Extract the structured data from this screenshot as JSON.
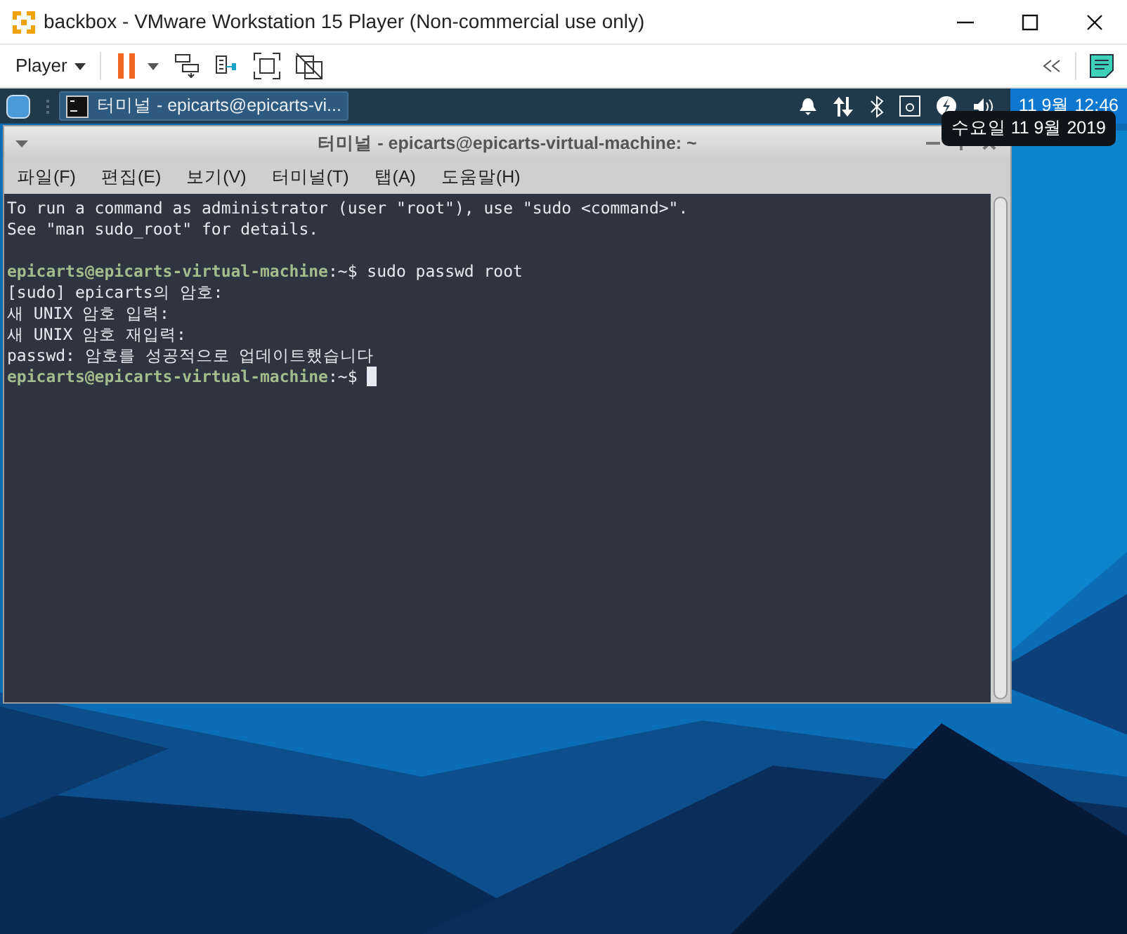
{
  "host_window": {
    "title": "backbox - VMware Workstation 15 Player (Non-commercial use only)"
  },
  "host_toolbar": {
    "player_menu": "Player",
    "paused": true
  },
  "guest_taskbar": {
    "task": {
      "label": "터미널 - epicarts@epicarts-vi...",
      "selected": true
    },
    "clock": "11 9월 12:46",
    "tooltip": "수요일 11 9월 2019"
  },
  "terminal": {
    "title": "터미널 - epicarts@epicarts-virtual-machine: ~",
    "menu": [
      "파일(F)",
      "편집(E)",
      "보기(V)",
      "터미널(T)",
      "탭(A)",
      "도움말(H)"
    ],
    "lines": [
      {
        "kind": "text",
        "segments": [
          {
            "kind": "plain",
            "text": "To run a command as administrator (user \"root\"), use \"sudo <command>\"."
          }
        ]
      },
      {
        "kind": "text",
        "segments": [
          {
            "kind": "plain",
            "text": "See \"man sudo_root\" for details."
          }
        ]
      },
      {
        "kind": "blank"
      },
      {
        "kind": "text",
        "segments": [
          {
            "kind": "prompt",
            "text": "epicarts@epicarts-virtual-machine"
          },
          {
            "kind": "plain",
            "text": ":~$ sudo passwd root"
          }
        ]
      },
      {
        "kind": "text",
        "segments": [
          {
            "kind": "plain",
            "text": "[sudo] epicarts의 암호:"
          }
        ]
      },
      {
        "kind": "text",
        "segments": [
          {
            "kind": "plain",
            "text": "새 UNIX 암호 입력:"
          }
        ]
      },
      {
        "kind": "text",
        "segments": [
          {
            "kind": "plain",
            "text": "새 UNIX 암호 재입력:"
          }
        ]
      },
      {
        "kind": "text",
        "segments": [
          {
            "kind": "plain",
            "text": "passwd: 암호를 성공적으로 업데이트했습니다"
          }
        ]
      },
      {
        "kind": "text",
        "segments": [
          {
            "kind": "prompt",
            "text": "epicarts@epicarts-virtual-machine"
          },
          {
            "kind": "plain",
            "text": ":~$ "
          },
          {
            "kind": "cursor"
          }
        ]
      }
    ]
  }
}
